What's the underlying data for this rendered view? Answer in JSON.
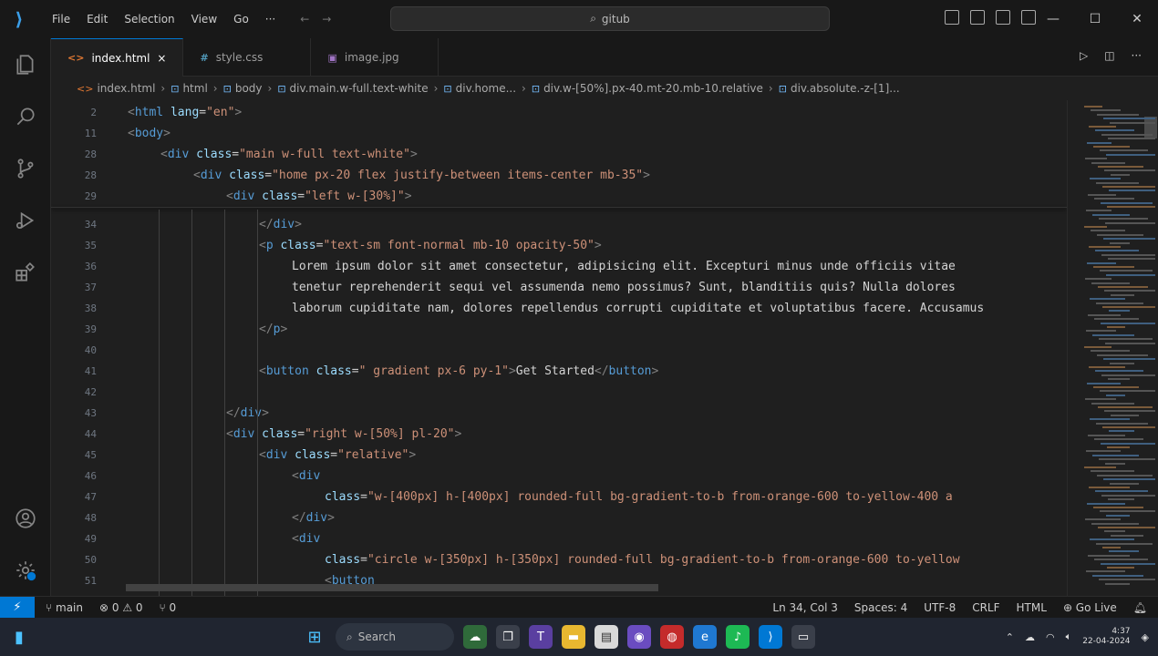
{
  "titlebar": {
    "menu": [
      "File",
      "Edit",
      "Selection",
      "View",
      "Go",
      "···"
    ],
    "search_text": "gitub",
    "window_controls": [
      "minimize",
      "maximize",
      "close"
    ]
  },
  "tabs": [
    {
      "label": "index.html",
      "icon": "html-icon",
      "active": true,
      "close": "×"
    },
    {
      "label": "style.css",
      "icon": "css-icon",
      "active": false
    },
    {
      "label": "image.jpg",
      "icon": "image-icon",
      "active": false
    }
  ],
  "breadcrumbs": [
    "index.html",
    "html",
    "body",
    "div.main.w-full.text-white",
    "div.home...",
    "div.w-[50%].px-40.mt-20.mb-10.relative",
    "div.absolute.-z-[1]..."
  ],
  "editor": {
    "lines": [
      {
        "n": "2",
        "indent": 0,
        "html": "<span class='tg'>&lt;</span><span class='tn'>html</span> <span class='an'>lang</span>=<span class='av'>\"en\"</span><span class='tg'>&gt;</span>"
      },
      {
        "n": "11",
        "indent": 0,
        "html": "<span class='tg'>&lt;</span><span class='tn'>body</span><span class='tg'>&gt;</span>"
      },
      {
        "n": "28",
        "indent": 1,
        "html": "<span class='tg'>&lt;</span><span class='tn'>div</span> <span class='an'>class</span>=<span class='av'>\"main w-full text-white\"</span><span class='tg'>&gt;</span>"
      },
      {
        "n": "28",
        "indent": 2,
        "html": "<span class='tg'>&lt;</span><span class='tn'>div</span> <span class='an'>class</span>=<span class='av'>\"home px-20 flex justify-between items-center mb-35\"</span><span class='tg'>&gt;</span>"
      },
      {
        "n": "29",
        "indent": 3,
        "html": "<span class='tg'>&lt;</span><span class='tn'>div</span> <span class='an'>class</span>=<span class='av'>\"left w-[30%]\"</span><span class='tg'>&gt;</span>"
      },
      {
        "n": "34",
        "indent": 4,
        "html": "<span class='tg'>&lt;/</span><span class='tn'>div</span><span class='tg'>&gt;</span>"
      },
      {
        "n": "35",
        "indent": 4,
        "html": "<span class='tg'>&lt;</span><span class='tn'>p</span> <span class='an'>class</span>=<span class='av'>\"text-sm font-normal mb-10 opacity-50\"</span><span class='tg'>&gt;</span>"
      },
      {
        "n": "36",
        "indent": 5,
        "html": "<span class='tx'>Lorem ipsum dolor sit amet consectetur, adipisicing elit. Excepturi minus unde officiis vitae</span>"
      },
      {
        "n": "37",
        "indent": 5,
        "html": "<span class='tx'>tenetur reprehenderit sequi vel assumenda nemo possimus? Sunt, blanditiis quis? Nulla dolores</span>"
      },
      {
        "n": "38",
        "indent": 5,
        "html": "<span class='tx'>laborum cupiditate nam, dolores repellendus corrupti cupiditate et voluptatibus facere. Accusamus</span>"
      },
      {
        "n": "39",
        "indent": 4,
        "html": "<span class='tg'>&lt;/</span><span class='tn'>p</span><span class='tg'>&gt;</span>"
      },
      {
        "n": "40",
        "indent": 0,
        "html": ""
      },
      {
        "n": "41",
        "indent": 4,
        "html": "<span class='tg'>&lt;</span><span class='tn'>button</span> <span class='an'>class</span>=<span class='av'>\" gradient px-6 py-1\"</span><span class='tg'>&gt;</span><span class='tx'>Get Started</span><span class='tg'>&lt;/</span><span class='tn'>button</span><span class='tg'>&gt;</span>"
      },
      {
        "n": "42",
        "indent": 0,
        "html": ""
      },
      {
        "n": "43",
        "indent": 3,
        "html": "<span class='tg'>&lt;/</span><span class='tn'>div</span><span class='tg'>&gt;</span>"
      },
      {
        "n": "44",
        "indent": 3,
        "html": "<span class='tg'>&lt;</span><span class='tn'>div</span> <span class='an'>class</span>=<span class='av'>\"right w-[50%] pl-20\"</span><span class='tg'>&gt;</span>"
      },
      {
        "n": "45",
        "indent": 4,
        "html": "<span class='tg'>&lt;</span><span class='tn'>div</span> <span class='an'>class</span>=<span class='av'>\"relative\"</span><span class='tg'>&gt;</span>"
      },
      {
        "n": "46",
        "indent": 5,
        "html": "<span class='tg'>&lt;</span><span class='tn'>div</span>"
      },
      {
        "n": "47",
        "indent": 6,
        "html": "<span class='an'>class</span>=<span class='av'>\"w-[400px] h-[400px] rounded-full bg-gradient-to-b from-orange-600 to-yellow-400 a</span>"
      },
      {
        "n": "48",
        "indent": 5,
        "html": "<span class='tg'>&lt;/</span><span class='tn'>div</span><span class='tg'>&gt;</span>"
      },
      {
        "n": "49",
        "indent": 5,
        "html": "<span class='tg'>&lt;</span><span class='tn'>div</span>"
      },
      {
        "n": "50",
        "indent": 6,
        "html": "<span class='an'>class</span>=<span class='av'>\"circle w-[350px] h-[350px] rounded-full bg-gradient-to-b from-orange-600 to-yellow</span>"
      },
      {
        "n": "51",
        "indent": 6,
        "html": "<span class='tg'>&lt;</span><span class='tn'>button</span>"
      }
    ]
  },
  "statusbar": {
    "remote": "⚡",
    "branch": "main",
    "problems": "⊗ 0 ⚠ 0",
    "ports": "⑂ 0",
    "right": [
      "Ln 34, Col 3",
      "Spaces: 4",
      "UTF-8",
      "CRLF",
      "HTML",
      "⊕ Go Live"
    ]
  },
  "taskbar": {
    "search_label": "Search",
    "time": "4:37",
    "date": "22-04-2024"
  }
}
